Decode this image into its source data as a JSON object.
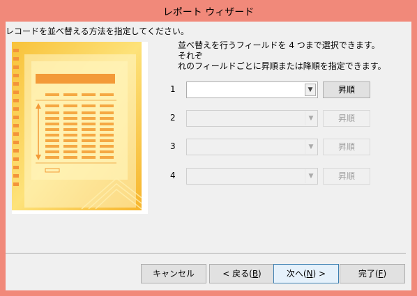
{
  "window": {
    "title": "レポート ウィザード"
  },
  "instruction": "レコードを並べ替える方法を指定してください。",
  "description": "並べ替えを行うフィールドを 4 つまで選択できます。それぞ\nれのフィールドごとに昇順または降順を指定できます。",
  "sort_rows": [
    {
      "number": "1",
      "field": "",
      "enabled": true,
      "order": "昇順"
    },
    {
      "number": "2",
      "field": "",
      "enabled": false,
      "order": "昇順"
    },
    {
      "number": "3",
      "field": "",
      "enabled": false,
      "order": "昇順"
    },
    {
      "number": "4",
      "field": "",
      "enabled": false,
      "order": "昇順"
    }
  ],
  "buttons": {
    "cancel": "キャンセル",
    "back_prefix": "< 戻る(",
    "back_key": "B",
    "back_suffix": ")",
    "next_prefix": "次へ(",
    "next_key": "N",
    "next_suffix": ") >",
    "finish_prefix": "完了(",
    "finish_key": "F",
    "finish_suffix": ")"
  },
  "icons": {
    "dropdown": "chevron-down-icon"
  },
  "colors": {
    "titlebar": "#f1897a",
    "illustration_orange": "#f5a030",
    "illustration_yellow": "#fcd94a"
  }
}
